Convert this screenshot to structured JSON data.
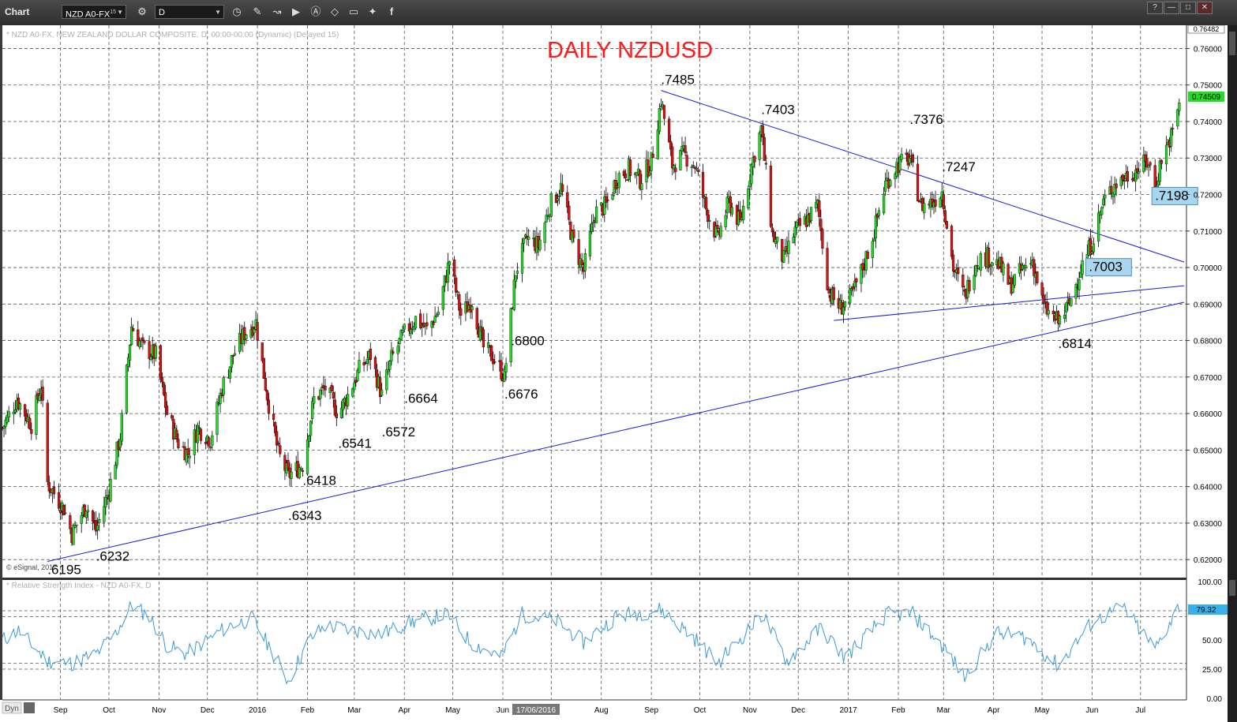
{
  "window": {
    "title": "Chart",
    "symbol": "NZD A0-FX",
    "symbol_sup": "15",
    "interval": "D",
    "icons": [
      "gear-icon",
      "clock-icon",
      "pencil-icon",
      "wave-icon",
      "play-icon",
      "alert-icon",
      "tag-icon",
      "chat-icon",
      "twitter-icon",
      "facebook-icon"
    ],
    "window_buttons": [
      "?",
      "—",
      "□",
      "✕"
    ]
  },
  "chart_labels": {
    "header": "* NZD A0-FX, NEW ZEALAND DOLLAR COMPOSITE, D, 00:00-00:00 (Dynamic) (Delayed 15)",
    "copyright": "© eSignal, 2017",
    "rsi_header": "* Relative Strength Index - NZD A0-FX, D",
    "dyn": "Dyn",
    "cursor_date": "17/06/2016",
    "price_top": "0.76482",
    "price_last": "0.74509",
    "rsi_last": "79.32"
  },
  "chart_data": [
    {
      "type": "candlestick",
      "title": "DAILY NZDUSD",
      "x_tick_labels": [
        "Sep",
        "Oct",
        "Nov",
        "Dec",
        "2016",
        "Feb",
        "Mar",
        "Apr",
        "May",
        "Jun",
        "Jul",
        "Aug",
        "Sep",
        "Oct",
        "Nov",
        "Dec",
        "2017",
        "Feb",
        "Mar",
        "Apr",
        "May",
        "Jun",
        "Jul"
      ],
      "y_tick_labels": [
        "0.76000",
        "0.75000",
        "0.74000",
        "0.73000",
        "0.72000",
        "0.71000",
        "0.70000",
        "0.69000",
        "0.68000",
        "0.67000",
        "0.66000",
        "0.65000",
        "0.64000",
        "0.63000",
        "0.62000"
      ],
      "ylim": [
        0.6155,
        0.7655
      ],
      "key_levels": [
        {
          "date": "2015-08-24",
          "price": 0.6195,
          "label": ".6195"
        },
        {
          "date": "2015-09-23",
          "price": 0.6232,
          "label": ".6232"
        },
        {
          "date": "2016-01-20",
          "price": 0.6343,
          "label": ".6343"
        },
        {
          "date": "2016-01-29",
          "price": 0.6418,
          "label": ".6418"
        },
        {
          "date": "2016-02-20",
          "price": 0.6541,
          "label": ".6541"
        },
        {
          "date": "2016-03-18",
          "price": 0.6572,
          "label": ".6572"
        },
        {
          "date": "2016-04-01",
          "price": 0.6664,
          "label": ".6664"
        },
        {
          "date": "2016-06-02",
          "price": 0.6676,
          "label": ".6676"
        },
        {
          "date": "2016-06-06",
          "price": 0.68,
          "label": ".6800"
        },
        {
          "date": "2016-09-07",
          "price": 0.7485,
          "label": ".7485"
        },
        {
          "date": "2016-11-08",
          "price": 0.7403,
          "label": ".7403"
        },
        {
          "date": "2017-02-08",
          "price": 0.7376,
          "label": ".7376"
        },
        {
          "date": "2017-02-28",
          "price": 0.7247,
          "label": ".7247"
        },
        {
          "date": "2017-05-11",
          "price": 0.6814,
          "label": ".6814"
        },
        {
          "date": "2017-05-30",
          "price": 0.7003,
          "label": ".7003",
          "boxed": true
        },
        {
          "date": "2017-07-10",
          "price": 0.7198,
          "label": ".7198",
          "boxed": true
        }
      ],
      "trendlines": [
        {
          "from": {
            "date": "2015-08-24",
            "price": 0.6195
          },
          "to": {
            "date": "2017-07-28",
            "price": 0.6905
          }
        },
        {
          "from": {
            "date": "2016-09-07",
            "price": 0.7485
          },
          "to": {
            "date": "2017-07-28",
            "price": 0.7015
          }
        },
        {
          "from": {
            "date": "2016-12-23",
            "price": 0.6855
          },
          "to": {
            "date": "2017-07-28",
            "price": 0.695
          }
        }
      ],
      "approx_close_path": [
        {
          "date": "2015-07-27",
          "price": 0.656
        },
        {
          "date": "2015-08-05",
          "price": 0.664
        },
        {
          "date": "2015-08-14",
          "price": 0.657
        },
        {
          "date": "2015-08-20",
          "price": 0.668
        },
        {
          "date": "2015-08-24",
          "price": 0.641
        },
        {
          "date": "2015-09-03",
          "price": 0.634
        },
        {
          "date": "2015-09-08",
          "price": 0.627
        },
        {
          "date": "2015-09-17",
          "price": 0.635
        },
        {
          "date": "2015-09-23",
          "price": 0.628
        },
        {
          "date": "2015-10-01",
          "price": 0.639
        },
        {
          "date": "2015-10-08",
          "price": 0.654
        },
        {
          "date": "2015-10-15",
          "price": 0.684
        },
        {
          "date": "2015-10-22",
          "price": 0.678
        },
        {
          "date": "2015-10-30",
          "price": 0.676
        },
        {
          "date": "2015-11-06",
          "price": 0.66
        },
        {
          "date": "2015-11-13",
          "price": 0.652
        },
        {
          "date": "2015-11-19",
          "price": 0.649
        },
        {
          "date": "2015-11-25",
          "price": 0.656
        },
        {
          "date": "2015-12-03",
          "price": 0.653
        },
        {
          "date": "2015-12-10",
          "price": 0.667
        },
        {
          "date": "2015-12-17",
          "price": 0.676
        },
        {
          "date": "2015-12-24",
          "price": 0.682
        },
        {
          "date": "2015-12-31",
          "price": 0.685
        },
        {
          "date": "2016-01-07",
          "price": 0.665
        },
        {
          "date": "2016-01-14",
          "price": 0.649
        },
        {
          "date": "2016-01-20",
          "price": 0.643
        },
        {
          "date": "2016-01-29",
          "price": 0.646
        },
        {
          "date": "2016-02-05",
          "price": 0.664
        },
        {
          "date": "2016-02-12",
          "price": 0.667
        },
        {
          "date": "2016-02-20",
          "price": 0.66
        },
        {
          "date": "2016-02-26",
          "price": 0.665
        },
        {
          "date": "2016-03-04",
          "price": 0.672
        },
        {
          "date": "2016-03-11",
          "price": 0.676
        },
        {
          "date": "2016-03-18",
          "price": 0.665
        },
        {
          "date": "2016-03-24",
          "price": 0.675
        },
        {
          "date": "2016-04-01",
          "price": 0.682
        },
        {
          "date": "2016-04-08",
          "price": 0.686
        },
        {
          "date": "2016-04-15",
          "price": 0.683
        },
        {
          "date": "2016-04-22",
          "price": 0.688
        },
        {
          "date": "2016-04-29",
          "price": 0.702
        },
        {
          "date": "2016-05-06",
          "price": 0.687
        },
        {
          "date": "2016-05-13",
          "price": 0.691
        },
        {
          "date": "2016-05-20",
          "price": 0.678
        },
        {
          "date": "2016-05-27",
          "price": 0.675
        },
        {
          "date": "2016-06-02",
          "price": 0.67
        },
        {
          "date": "2016-06-09",
          "price": 0.699
        },
        {
          "date": "2016-06-16",
          "price": 0.708
        },
        {
          "date": "2016-06-23",
          "price": 0.706
        },
        {
          "date": "2016-06-30",
          "price": 0.717
        },
        {
          "date": "2016-07-07",
          "price": 0.722
        },
        {
          "date": "2016-07-14",
          "price": 0.708
        },
        {
          "date": "2016-07-21",
          "price": 0.699
        },
        {
          "date": "2016-07-28",
          "price": 0.715
        },
        {
          "date": "2016-08-04",
          "price": 0.717
        },
        {
          "date": "2016-08-11",
          "price": 0.725
        },
        {
          "date": "2016-08-18",
          "price": 0.727
        },
        {
          "date": "2016-08-25",
          "price": 0.724
        },
        {
          "date": "2016-09-01",
          "price": 0.729
        },
        {
          "date": "2016-09-07",
          "price": 0.746
        },
        {
          "date": "2016-09-14",
          "price": 0.728
        },
        {
          "date": "2016-09-21",
          "price": 0.731
        },
        {
          "date": "2016-09-28",
          "price": 0.728
        },
        {
          "date": "2016-10-05",
          "price": 0.716
        },
        {
          "date": "2016-10-12",
          "price": 0.708
        },
        {
          "date": "2016-10-19",
          "price": 0.718
        },
        {
          "date": "2016-10-26",
          "price": 0.712
        },
        {
          "date": "2016-11-02",
          "price": 0.728
        },
        {
          "date": "2016-11-08",
          "price": 0.738
        },
        {
          "date": "2016-11-15",
          "price": 0.709
        },
        {
          "date": "2016-11-22",
          "price": 0.702
        },
        {
          "date": "2016-11-29",
          "price": 0.71
        },
        {
          "date": "2016-12-06",
          "price": 0.713
        },
        {
          "date": "2016-12-13",
          "price": 0.717
        },
        {
          "date": "2016-12-20",
          "price": 0.693
        },
        {
          "date": "2016-12-27",
          "price": 0.689
        },
        {
          "date": "2017-01-03",
          "price": 0.692
        },
        {
          "date": "2017-01-10",
          "price": 0.7
        },
        {
          "date": "2017-01-17",
          "price": 0.71
        },
        {
          "date": "2017-01-24",
          "price": 0.723
        },
        {
          "date": "2017-01-31",
          "price": 0.728
        },
        {
          "date": "2017-02-08",
          "price": 0.73
        },
        {
          "date": "2017-02-15",
          "price": 0.717
        },
        {
          "date": "2017-02-22",
          "price": 0.718
        },
        {
          "date": "2017-02-28",
          "price": 0.721
        },
        {
          "date": "2017-03-07",
          "price": 0.7
        },
        {
          "date": "2017-03-14",
          "price": 0.692
        },
        {
          "date": "2017-03-21",
          "price": 0.702
        },
        {
          "date": "2017-03-28",
          "price": 0.703
        },
        {
          "date": "2017-04-04",
          "price": 0.701
        },
        {
          "date": "2017-04-11",
          "price": 0.695
        },
        {
          "date": "2017-04-18",
          "price": 0.699
        },
        {
          "date": "2017-04-25",
          "price": 0.702
        },
        {
          "date": "2017-05-02",
          "price": 0.689
        },
        {
          "date": "2017-05-11",
          "price": 0.685
        },
        {
          "date": "2017-05-18",
          "price": 0.69
        },
        {
          "date": "2017-05-25",
          "price": 0.7
        },
        {
          "date": "2017-06-01",
          "price": 0.707
        },
        {
          "date": "2017-06-08",
          "price": 0.718
        },
        {
          "date": "2017-06-15",
          "price": 0.723
        },
        {
          "date": "2017-06-22",
          "price": 0.725
        },
        {
          "date": "2017-06-29",
          "price": 0.727
        },
        {
          "date": "2017-07-06",
          "price": 0.729
        },
        {
          "date": "2017-07-10",
          "price": 0.722
        },
        {
          "date": "2017-07-14",
          "price": 0.73
        },
        {
          "date": "2017-07-21",
          "price": 0.737
        },
        {
          "date": "2017-07-25",
          "price": 0.7451
        }
      ]
    },
    {
      "type": "line",
      "title": "",
      "ylim": [
        0,
        100
      ],
      "y_tick_labels": [
        "100.00",
        "75.00",
        "50.00",
        "25.00",
        "0.00"
      ],
      "series": [
        {
          "name": "Relative Strength Index",
          "values": [
            {
              "date": "2015-07-27",
              "rsi": 50
            },
            {
              "date": "2015-08-06",
              "rsi": 58
            },
            {
              "date": "2015-08-24",
              "rsi": 32
            },
            {
              "date": "2015-09-08",
              "rsi": 30
            },
            {
              "date": "2015-09-23",
              "rsi": 38
            },
            {
              "date": "2015-10-05",
              "rsi": 55
            },
            {
              "date": "2015-10-15",
              "rsi": 80
            },
            {
              "date": "2015-10-26",
              "rsi": 70
            },
            {
              "date": "2015-11-06",
              "rsi": 45
            },
            {
              "date": "2015-11-18",
              "rsi": 38
            },
            {
              "date": "2015-12-01",
              "rsi": 50
            },
            {
              "date": "2015-12-14",
              "rsi": 62
            },
            {
              "date": "2015-12-29",
              "rsi": 68
            },
            {
              "date": "2016-01-11",
              "rsi": 38
            },
            {
              "date": "2016-01-20",
              "rsi": 15
            },
            {
              "date": "2016-02-02",
              "rsi": 50
            },
            {
              "date": "2016-02-12",
              "rsi": 62
            },
            {
              "date": "2016-03-01",
              "rsi": 58
            },
            {
              "date": "2016-03-18",
              "rsi": 55
            },
            {
              "date": "2016-04-04",
              "rsi": 65
            },
            {
              "date": "2016-04-28",
              "rsi": 72
            },
            {
              "date": "2016-05-12",
              "rsi": 48
            },
            {
              "date": "2016-05-31",
              "rsi": 35
            },
            {
              "date": "2016-06-13",
              "rsi": 72
            },
            {
              "date": "2016-07-05",
              "rsi": 66
            },
            {
              "date": "2016-07-21",
              "rsi": 48
            },
            {
              "date": "2016-08-10",
              "rsi": 70
            },
            {
              "date": "2016-09-07",
              "rsi": 76
            },
            {
              "date": "2016-09-29",
              "rsi": 50
            },
            {
              "date": "2016-10-12",
              "rsi": 30
            },
            {
              "date": "2016-11-09",
              "rsi": 72
            },
            {
              "date": "2016-11-24",
              "rsi": 32
            },
            {
              "date": "2016-12-15",
              "rsi": 60
            },
            {
              "date": "2016-12-30",
              "rsi": 35
            },
            {
              "date": "2017-01-25",
              "rsi": 72
            },
            {
              "date": "2017-02-10",
              "rsi": 72
            },
            {
              "date": "2017-03-02",
              "rsi": 42
            },
            {
              "date": "2017-03-14",
              "rsi": 18
            },
            {
              "date": "2017-04-03",
              "rsi": 56
            },
            {
              "date": "2017-04-21",
              "rsi": 52
            },
            {
              "date": "2017-05-11",
              "rsi": 28
            },
            {
              "date": "2017-06-01",
              "rsi": 65
            },
            {
              "date": "2017-06-20",
              "rsi": 78
            },
            {
              "date": "2017-07-10",
              "rsi": 42
            },
            {
              "date": "2017-07-25",
              "rsi": 79.32
            }
          ]
        }
      ],
      "reference_lines": [
        75,
        70,
        30,
        25
      ]
    }
  ],
  "colors": {
    "bull": "#22dd22",
    "bear": "#dd1111",
    "trendline": "#1a1ad8",
    "rsi_line": "#3a9ad9",
    "title": "#ff1a1a",
    "price_tag": "#22dd22",
    "rsi_tag": "#3ab0e8",
    "boxed_label_bg": "#a9d6ef",
    "boxed_label_border": "#4a90c8"
  }
}
